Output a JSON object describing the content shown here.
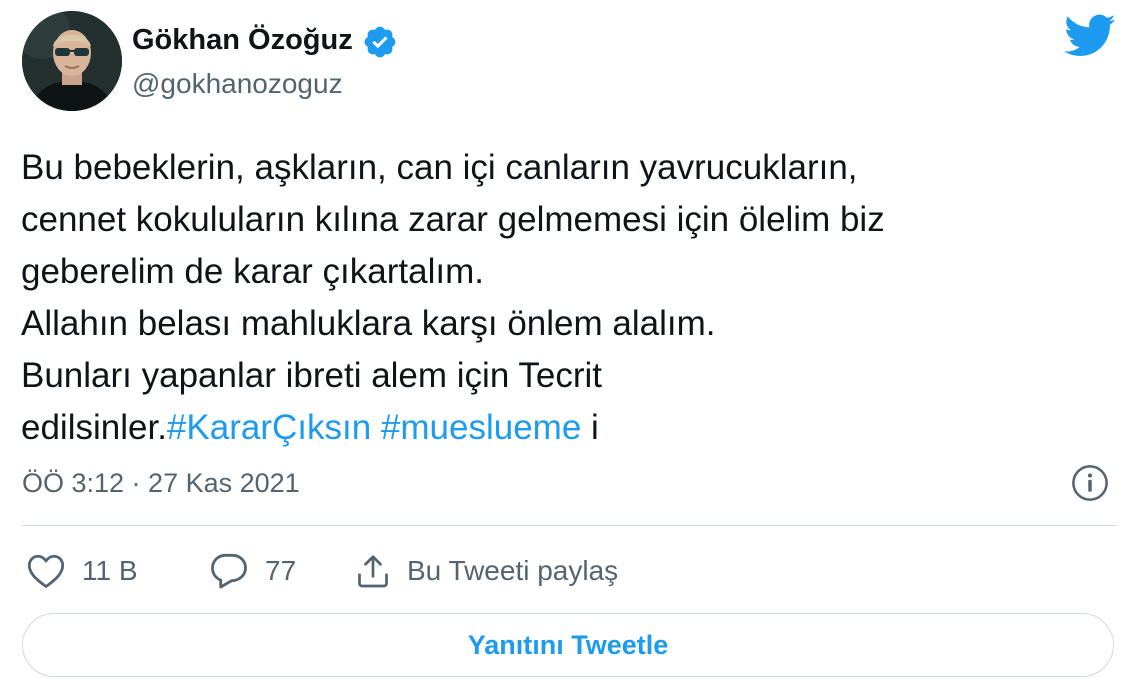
{
  "author": {
    "name": "Gökhan Özoğuz",
    "handle": "@gokhanozoguz",
    "verified": true
  },
  "tweet": {
    "lines": [
      "Bu bebeklerin, aşkların, can içi canların yavrucukların,",
      "cennet kokuluların kılına zarar gelmemesi için ölelim biz",
      "geberelim de karar çıkartalım.",
      "Allahın belası mahluklara karşı önlem alalım.",
      "Bunları yapanlar ibreti alem için Tecrit"
    ],
    "last_line": {
      "text_before": "edilsinler.",
      "hashtag_1": "#KararÇıksın",
      "space": " ",
      "hashtag_2": "#mueslueme",
      "text_after": " i"
    },
    "timestamp": "ÖÖ 3:12 · 27 Kas 2021"
  },
  "actions": {
    "like_count": "11 B",
    "reply_count": "77",
    "share_label": "Bu Tweeti paylaş"
  },
  "reply_button_label": "Yanıtını Tweetle",
  "icons": {
    "verified": "verified-badge-icon",
    "brand": "twitter-bird-icon",
    "info": "info-icon",
    "like": "heart-icon",
    "reply": "speech-bubble-icon",
    "share": "share-icon"
  },
  "colors": {
    "accent": "#1d9bf0",
    "text": "#0f1419",
    "secondary": "#536471",
    "border": "#cfd9de"
  }
}
